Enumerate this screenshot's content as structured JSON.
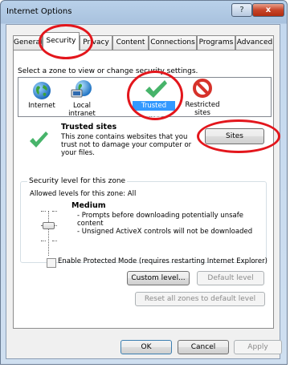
{
  "window": {
    "title": "Internet Options",
    "help_glyph": "?",
    "close_glyph": "x"
  },
  "tabs": [
    {
      "label": "General"
    },
    {
      "label": "Security"
    },
    {
      "label": "Privacy"
    },
    {
      "label": "Content"
    },
    {
      "label": "Connections"
    },
    {
      "label": "Programs"
    },
    {
      "label": "Advanced"
    }
  ],
  "security": {
    "zone_prompt": "Select a zone to view or change security settings.",
    "zones": [
      {
        "label": "Internet",
        "icon": "globe-icon"
      },
      {
        "label": "Local intranet",
        "icon": "intranet-globe-icon"
      },
      {
        "label": "Trusted sites",
        "icon": "checkmark-icon",
        "selected": true
      },
      {
        "label": "Restricted",
        "label2": "sites",
        "icon": "no-entry-icon"
      }
    ],
    "selected_zone": {
      "title": "Trusted sites",
      "description_lines": [
        "This zone contains websites that you",
        "trust not to damage your computer or",
        "your files."
      ]
    },
    "sites_button": "Sites",
    "level_group_label": "Security level for this zone",
    "allowed_levels": "Allowed levels for this zone: All",
    "level_name": "Medium",
    "level_bullets": [
      "- Prompts before downloading potentially unsafe",
      "content",
      "- Unsigned ActiveX controls will not be downloaded"
    ],
    "protected_mode_label": "Enable Protected Mode (requires restarting Internet Explorer)",
    "custom_level_button": "Custom level...",
    "default_level_button": "Default level",
    "reset_all_button": "Reset all zones to default level"
  },
  "footer": {
    "ok": "OK",
    "cancel": "Cancel",
    "apply": "Apply"
  },
  "colors": {
    "highlight": "#3399ff",
    "annotation_red": "#e3161c",
    "check_green": "#2fa84f"
  }
}
